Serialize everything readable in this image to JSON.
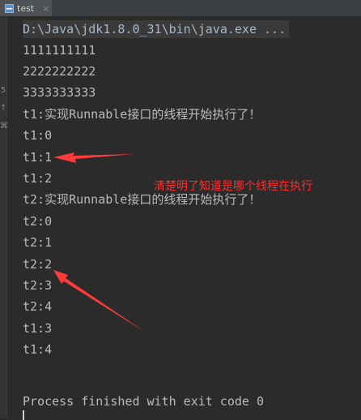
{
  "tab": {
    "label": "test",
    "close": "×"
  },
  "gutter": {
    "marks": [
      "5",
      "↑",
      "⌘"
    ]
  },
  "console": {
    "command": "D:\\Java\\jdk1.8.0_31\\bin\\java.exe ...",
    "lines": [
      "1111111111",
      "2222222222",
      "3333333333",
      "t1:实现Runnable接口的线程开始执行了！",
      "t1:0",
      "t1:1",
      "t1:2",
      "t2:实现Runnable接口的线程开始执行了！",
      "t2:0",
      "t2:1",
      "t2:2",
      "t2:3",
      "t2:4",
      "t1:3",
      "t1:4"
    ],
    "exit_message": "Process finished with exit code 0"
  },
  "annotation": {
    "text": "清楚明了知道是哪个线程在执行"
  },
  "colors": {
    "annotation": "#ff2d2d",
    "background": "#2b2b2b",
    "tab": "#4e5254"
  }
}
